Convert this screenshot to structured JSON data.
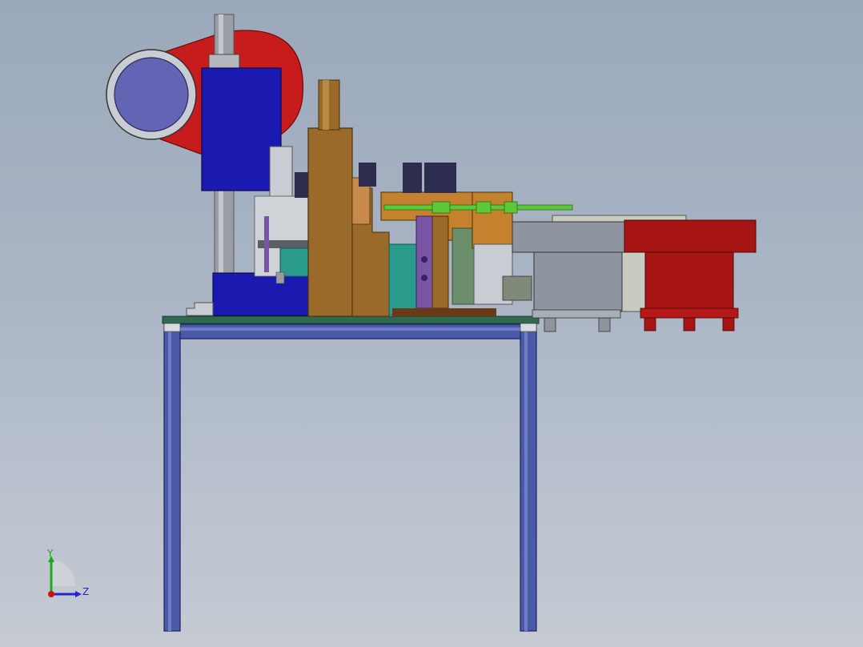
{
  "view": {
    "background_top": "#9aa9bb",
    "background_bottom": "#c6cbd3"
  },
  "triad": {
    "y_label": "Y",
    "z_label": "Z",
    "y_color": "#1fa81f",
    "z_color": "#2424c8",
    "origin_color": "#c81414"
  },
  "palette": {
    "frame_blue": "#3f4f9e",
    "motor_blue": "#1a1ab0",
    "flywheel_red": "#c81c1c",
    "post_gray": "#9a9ea4",
    "bracket_brown": "#9a6a2a",
    "feeder_gray": "#8f959e",
    "feeder_red": "#a61414",
    "rod_green": "#5ec83a",
    "teal": "#2a9a8c",
    "purple": "#7a55a6"
  }
}
